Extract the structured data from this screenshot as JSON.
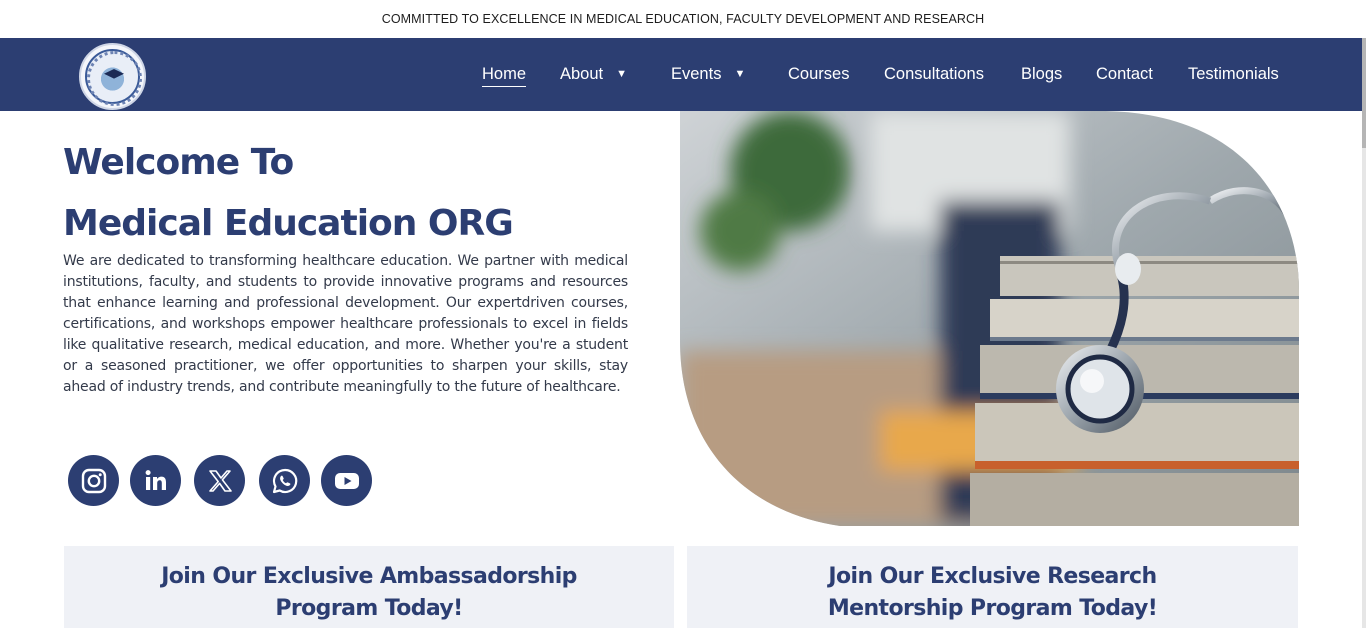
{
  "topbar": {
    "text": "COMMITTED TO EXCELLENCE IN MEDICAL EDUCATION, FACULTY DEVELOPMENT AND RESEARCH"
  },
  "nav": {
    "logo_icon": "medical-education-logo",
    "items": [
      {
        "label": "Home",
        "active": true
      },
      {
        "label": "About",
        "dropdown": true
      },
      {
        "label": "Events",
        "dropdown": true
      },
      {
        "label": "Courses"
      },
      {
        "label": "Consultations"
      },
      {
        "label": "Blogs"
      },
      {
        "label": "Contact"
      },
      {
        "label": "Testimonials"
      }
    ],
    "caret": "▼"
  },
  "hero": {
    "title_line1": "Welcome To",
    "title_line2": "Medical Education ORG",
    "description": "We are dedicated to transforming healthcare education. We partner with medical institutions, faculty, and students to provide innovative programs and resources that enhance learning and professional development. Our expertdriven courses, certifications, and workshops empower healthcare professionals to excel in fields like qualitative research, medical education, and more. Whether you're a student or a seasoned practitioner, we offer opportunities to sharpen your skills, stay ahead of industry trends, and contribute meaningfully to the future of healthcare.",
    "image": "stethoscope-on-books-photo"
  },
  "socials": [
    "instagram-icon",
    "linkedin-icon",
    "x-icon",
    "whatsapp-icon",
    "youtube-icon"
  ],
  "cards": [
    {
      "line1": "Join Our Exclusive Ambassadorship",
      "line2": "Program Today!"
    },
    {
      "line1": "Join Our Exclusive Research",
      "line2": "Mentorship Program Today!"
    }
  ],
  "colors": {
    "brand": "#2c3e72",
    "card_bg": "#eff1f6"
  }
}
